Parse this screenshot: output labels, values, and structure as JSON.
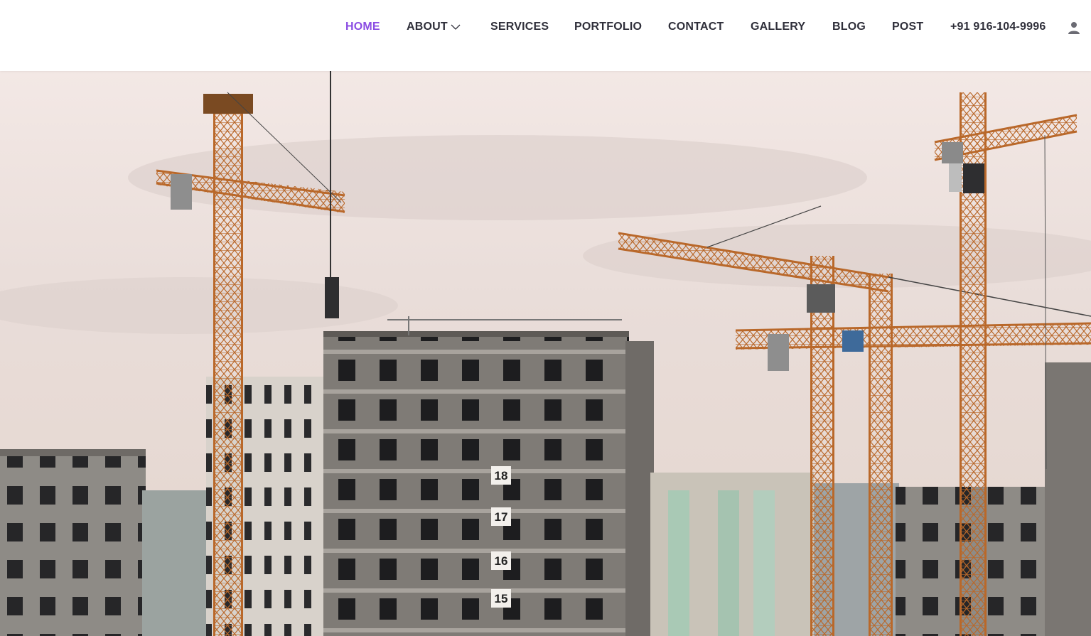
{
  "nav": {
    "items": [
      {
        "label": "HOME",
        "active": true
      },
      {
        "label": "ABOUT",
        "has_dropdown": true
      },
      {
        "label": "SERVICES"
      },
      {
        "label": "PORTFOLIO"
      },
      {
        "label": "CONTACT"
      },
      {
        "label": "GALLERY"
      },
      {
        "label": "BLOG"
      },
      {
        "label": "POST"
      }
    ],
    "phone": "+91 916-104-9996",
    "user_icon": "user-icon",
    "dropdown_icon": "chevron-down-icon"
  },
  "hero": {
    "image": "construction-site-with-tower-cranes",
    "floor_labels": [
      "18",
      "17",
      "16",
      "15"
    ]
  },
  "colors": {
    "accent": "#8b4de3",
    "nav_text": "#2f2f3a",
    "crane": "#c8782c"
  }
}
